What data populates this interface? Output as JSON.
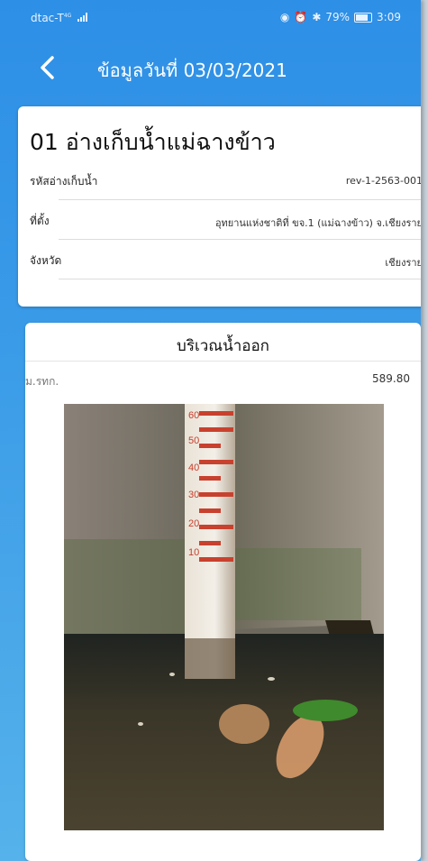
{
  "status_bar": {
    "carrier": "dtac-T",
    "network": "4G",
    "battery": "79%",
    "time": "3:09",
    "icons": [
      "eye-icon",
      "alarm-icon",
      "bluetooth-icon",
      "battery-icon"
    ]
  },
  "header": {
    "title": "ข้อมูลวันที่ 03/03/2021",
    "back_icon": "chevron-left-icon"
  },
  "reservoir": {
    "name": "01 อ่างเก็บน้ำแม่ฉางข้าว",
    "fields": [
      {
        "label": "รหัสอ่างเก็บน้ำ",
        "value": "rev-1-2563-001"
      },
      {
        "label": "ที่ตั้ง",
        "value": "อุทยานแห่งชาติที่ ขจ.1 (แม่ฉางข้าว) จ.เชียงราย"
      },
      {
        "label": "จังหวัด",
        "value": "เชียงราย"
      }
    ]
  },
  "outlet": {
    "title": "บริเวณน้ำออก",
    "measure_label": "ม.รทก.",
    "measure_value": "589.80",
    "gauge_labels": [
      "60",
      "50",
      "40",
      "30",
      "20",
      "10"
    ]
  },
  "colors": {
    "app_blue": "#2d8fe6",
    "card_white": "#ffffff"
  }
}
